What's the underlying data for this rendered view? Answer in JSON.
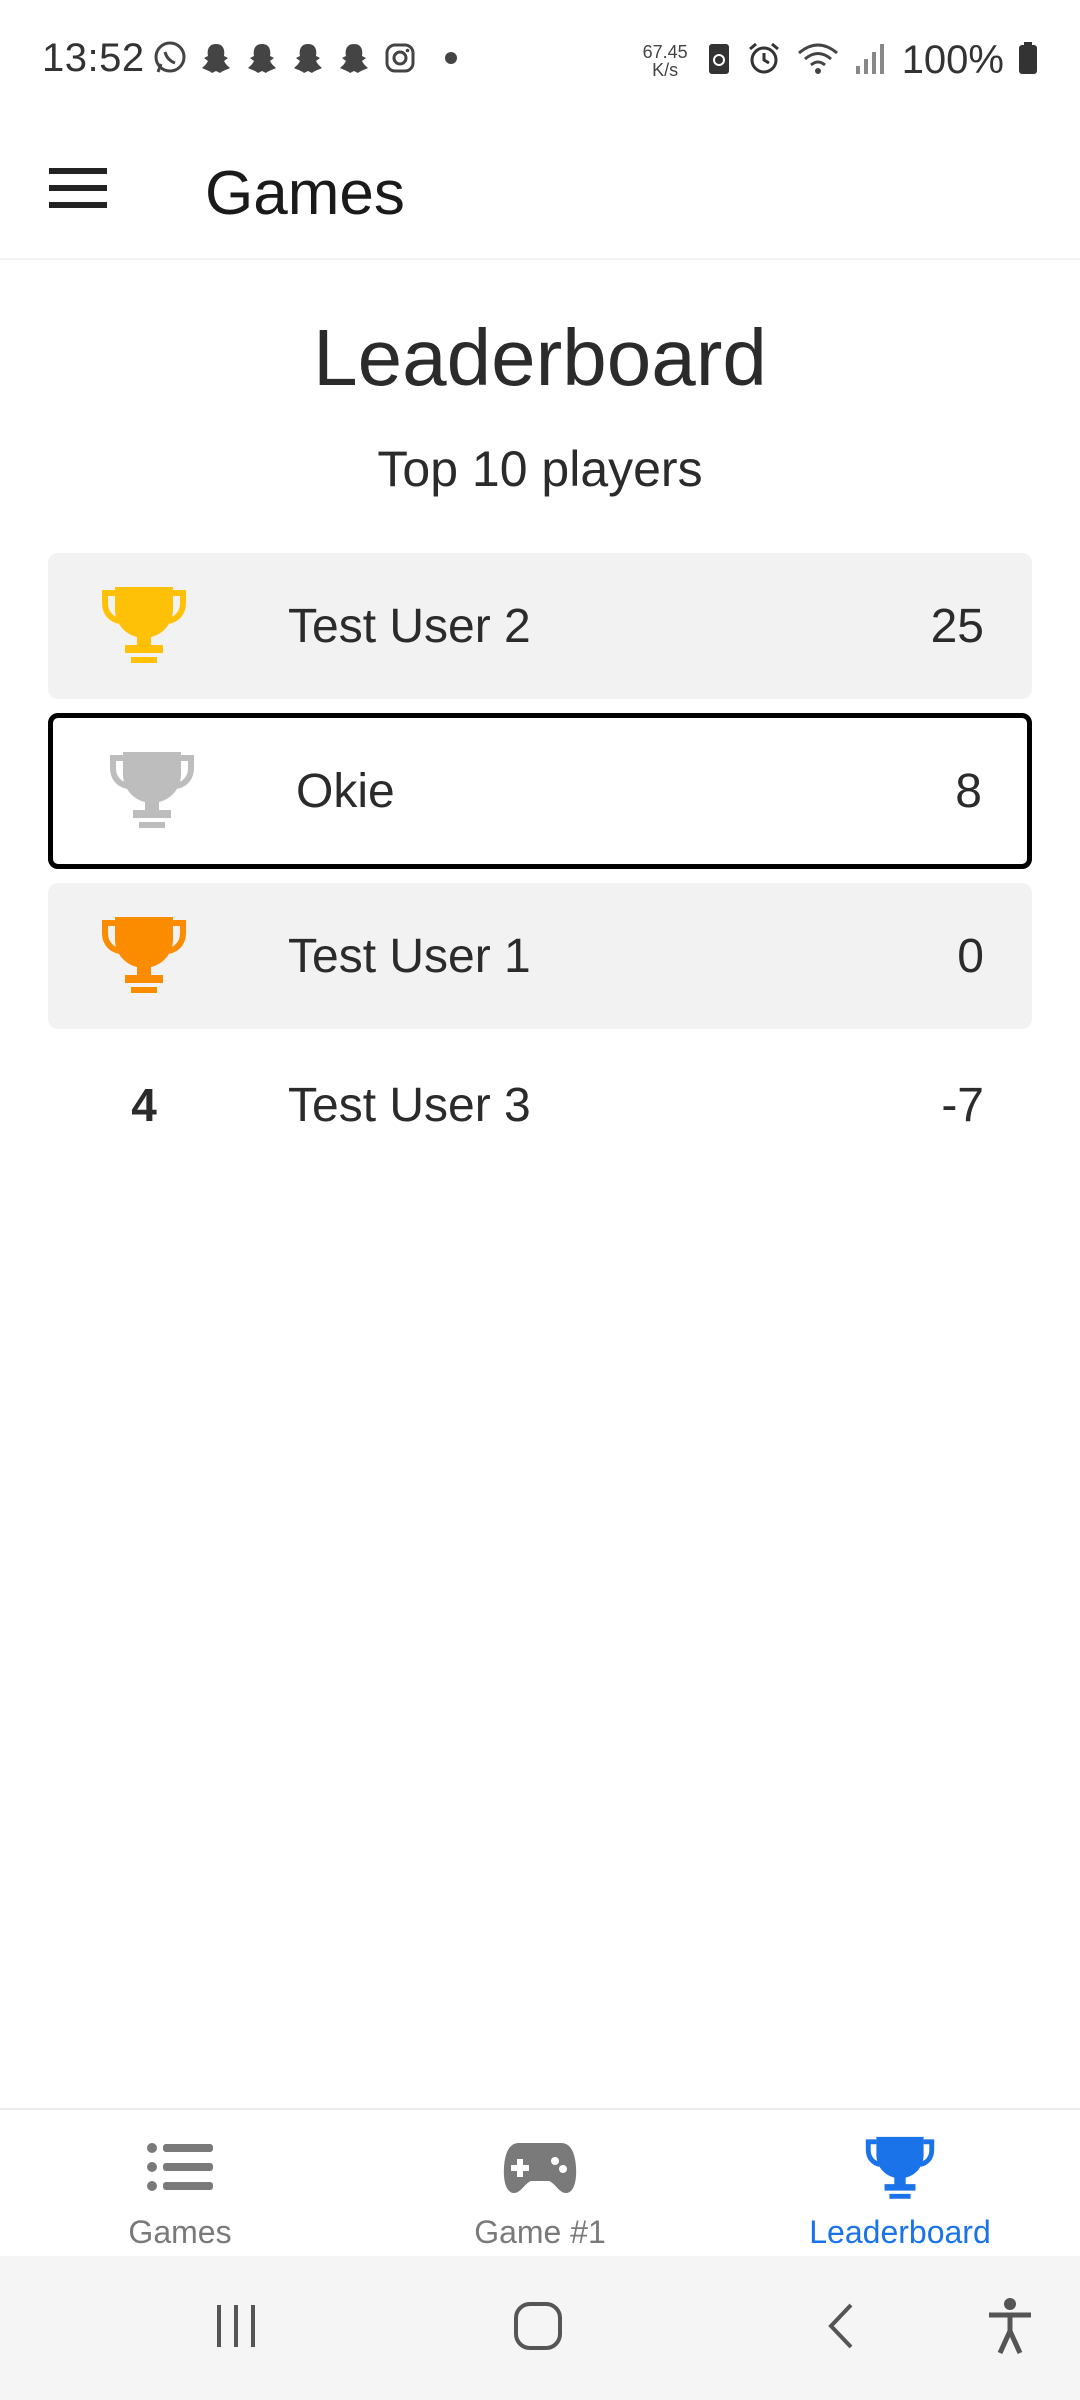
{
  "status_bar": {
    "time": "13:52",
    "net_speed_value": "67.45",
    "net_speed_unit": "K/s",
    "battery": "100%",
    "left_icons": [
      "whatsapp-icon",
      "snapchat-icon",
      "snapchat-icon",
      "snapchat-icon",
      "snapchat-icon",
      "instagram-icon",
      "dot-icon"
    ],
    "right_icons": [
      "data-saver-icon",
      "alarm-icon",
      "wifi-icon",
      "signal-icon",
      "battery-icon"
    ]
  },
  "app_bar": {
    "menu_icon": "hamburger-menu-icon",
    "title": "Games"
  },
  "leaderboard": {
    "title": "Leaderboard",
    "subtitle": "Top 10 players",
    "rows": [
      {
        "rank": 1,
        "rank_display": "gold-trophy-icon",
        "name": "Test User 2",
        "score": "25",
        "highlight": false
      },
      {
        "rank": 2,
        "rank_display": "silver-trophy-icon",
        "name": "Okie",
        "score": "8",
        "highlight": true
      },
      {
        "rank": 3,
        "rank_display": "bronze-trophy-icon",
        "name": "Test User 1",
        "score": "0",
        "highlight": false
      },
      {
        "rank": 4,
        "rank_display": "4",
        "name": "Test User 3",
        "score": "-7",
        "highlight": false
      }
    ]
  },
  "bottom_nav": {
    "tabs": [
      {
        "label": "Games",
        "icon": "list-icon",
        "active": false
      },
      {
        "label": "Game #1",
        "icon": "gamepad-icon",
        "active": false
      },
      {
        "label": "Leaderboard",
        "icon": "trophy-icon",
        "active": true
      }
    ]
  },
  "system_nav": {
    "buttons": [
      "recent-apps-icon",
      "home-icon",
      "back-icon",
      "accessibility-icon"
    ]
  },
  "colors": {
    "gold": "#FFC107",
    "silver": "#BDBDBD",
    "bronze": "#FB8C00",
    "accent": "#1A73E8",
    "row_shade": "#F2F2F2",
    "inactive": "#7A7A7A"
  }
}
